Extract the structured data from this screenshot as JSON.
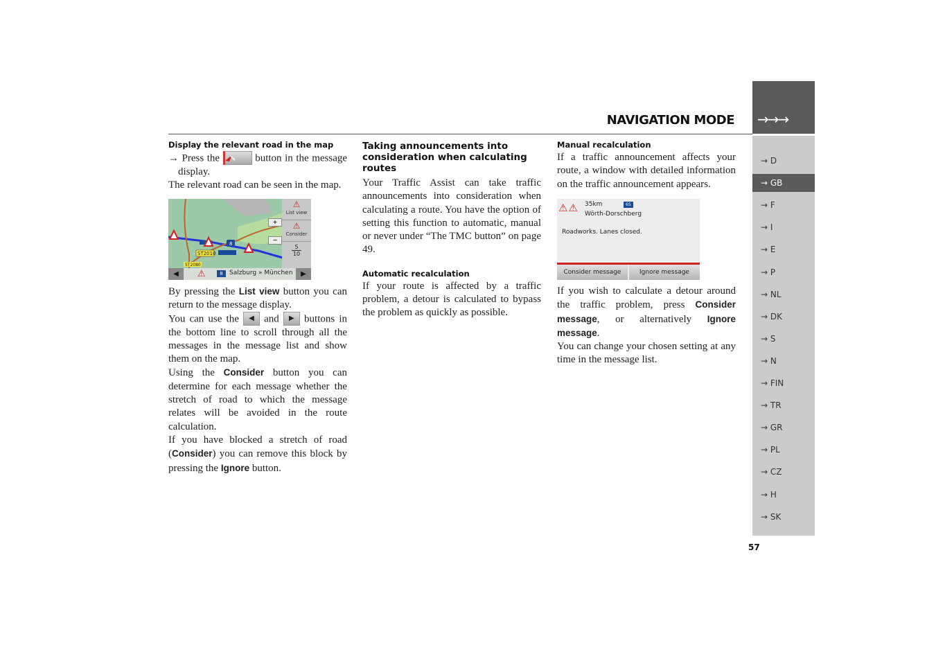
{
  "header": {
    "title": "NAVIGATION MODE",
    "arrows": "→→→"
  },
  "sidebar": {
    "items": [
      {
        "label": "→ D"
      },
      {
        "label": "→ GB",
        "active": true
      },
      {
        "label": "→ F"
      },
      {
        "label": "→ I"
      },
      {
        "label": "→ E"
      },
      {
        "label": "→ P"
      },
      {
        "label": "→ NL"
      },
      {
        "label": "→ DK"
      },
      {
        "label": "→ S"
      },
      {
        "label": "→ N"
      },
      {
        "label": "→ FIN"
      },
      {
        "label": "→ TR"
      },
      {
        "label": "→ GR"
      },
      {
        "label": "→ PL"
      },
      {
        "label": "→ CZ"
      },
      {
        "label": "→ H"
      },
      {
        "label": "→ SK"
      }
    ]
  },
  "page_number": "57",
  "col1": {
    "heading": "Display the relevant road in the map",
    "step_pre": "→ Press the",
    "step_post": "button in the message display.",
    "p1": "The relevant road can be seen in the map.",
    "p2_a": "By pressing the ",
    "p2_b": "List view",
    "p2_c": " button you can return to the message display.",
    "p3_a": "You can use the ",
    "p3_b": " and ",
    "p3_c": " buttons in the bottom line to scroll through all the messages in the message list and show them on the map.",
    "p4_a": "Using the ",
    "p4_b": "Consider",
    "p4_c": " button you can determine for each message whether the stretch of road to which the message relates will be avoided in the route calculation.",
    "p5_a": "If you have blocked a stretch of road (",
    "p5_b": "Consider",
    "p5_c": ") you can remove this block by pressing the ",
    "p5_d": "Ignore",
    "p5_e": " button."
  },
  "map_screen": {
    "list_view": "List view",
    "consider": "Consider",
    "page_top": "5",
    "page_bottom": "10",
    "zoom_in": "+",
    "zoom_out": "−",
    "road_label_1": "ST2010",
    "road_label_2": "ST2080",
    "route_badge": "8",
    "route_text": "Salzburg » München"
  },
  "col2": {
    "heading": "Taking announcements into consideration when calculating routes",
    "p1": "Your Traffic Assist can take traffic announcements into consideration when calculating a route. You have the option of setting this function to automatic, manual or never under “The TMC button” on page 49.",
    "heading2": "Automatic recalculation",
    "p2": "If your route is affected by a traffic problem, a detour is calculated to bypass the problem as quickly as possible."
  },
  "col3": {
    "heading": "Manual recalculation",
    "p1": "If a traffic announcement affects your route, a window with detailed information on the traffic announcement appears.",
    "p2_a": "If you wish to calculate a detour around the traffic problem, press ",
    "p2_b": "Consider message",
    "p2_c": ", or alternatively ",
    "p2_d": "Ignore message",
    "p2_e": ".",
    "p3": "You can change your chosen setting at any time in the message list."
  },
  "message_screen": {
    "distance": "35km",
    "road_badge": "65",
    "location": "Wörth-Dorschberg",
    "message": "Roadworks. Lanes closed.",
    "consider_btn": "Consider message",
    "ignore_btn": "Ignore message"
  }
}
